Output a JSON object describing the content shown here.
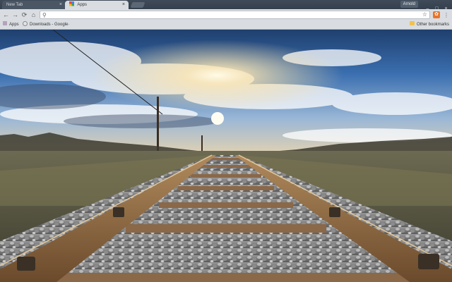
{
  "tabs": [
    {
      "title": "New Tab",
      "active": false,
      "close": "×"
    },
    {
      "title": "Apps",
      "active": true,
      "close": "×"
    }
  ],
  "profile": {
    "name": "Arnold"
  },
  "window_controls": {
    "minimize": "–",
    "maximize": "□",
    "close": "×"
  },
  "toolbar": {
    "back": "←",
    "forward": "→",
    "reload": "⟳",
    "home": "⌂",
    "omnibox_value": "",
    "omnibox_placeholder": "",
    "star": "☆",
    "menu": "⋮"
  },
  "bookmarks": {
    "apps": "Apps",
    "downloads": "Downloads - Google·",
    "other": "Other bookmarks"
  },
  "icons": {
    "search": "search-icon",
    "bookmark_star": "star-icon",
    "extension": "extension-icon",
    "apps": "apps-grid-icon",
    "globe": "globe-icon",
    "folder": "folder-icon"
  },
  "colors": {
    "frame": "#3f4b59",
    "toolbar": "#d9dde1",
    "extension": "#e8742c"
  }
}
